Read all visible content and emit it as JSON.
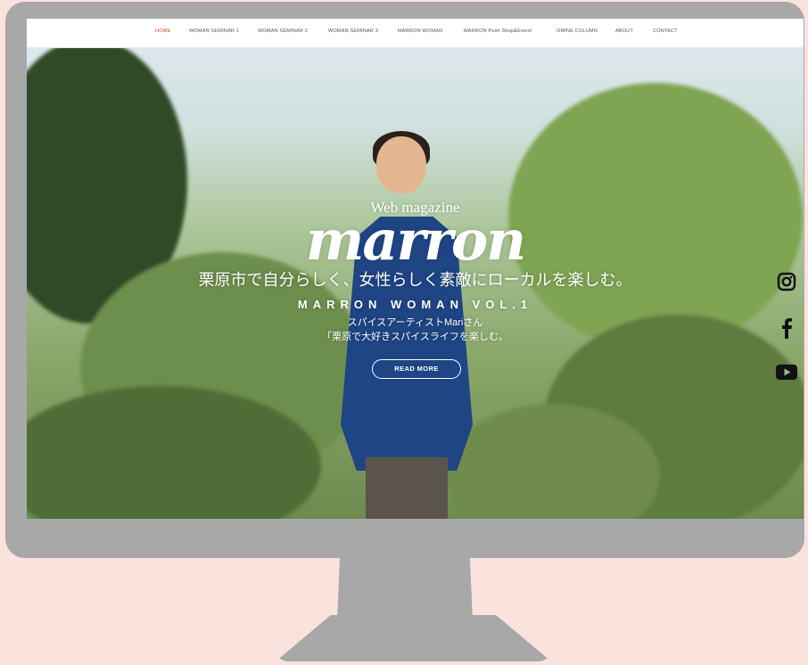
{
  "nav": {
    "items": [
      {
        "label": "HOME",
        "active": true
      },
      {
        "label": "WOMAN SEMINAR 1",
        "active": false
      },
      {
        "label": "WOMAN SEMINAR 2",
        "active": false
      },
      {
        "label": "WOMAN SEMINAR 3",
        "active": false
      },
      {
        "label": "MARRON WOMAN",
        "active": false
      },
      {
        "label": "MARRON Push Shop&Event!",
        "active": false
      },
      {
        "label": "OMINE COLUMN",
        "active": false
      },
      {
        "label": "ABOUT",
        "active": false
      },
      {
        "label": "CONTACT",
        "active": false
      }
    ],
    "active_color": "#c8511e"
  },
  "hero": {
    "kicker": "Web magazine",
    "logo": "marron",
    "tagline": "栗原市で自分らしく、女性らしく素敵にローカルを楽しむ。",
    "feature_title": "MARRON WOMAN VOL.1",
    "subtitle_1": "スパイスアーティストMariさん",
    "subtitle_2": "「栗原で大好きスパイスライフを楽しむ。",
    "cta_label": "READ MORE"
  },
  "social": {
    "icons": [
      "instagram-icon",
      "facebook-icon",
      "youtube-icon"
    ]
  },
  "colors": {
    "background": "#fbe3dd",
    "monitor": "#a8a8a8"
  }
}
